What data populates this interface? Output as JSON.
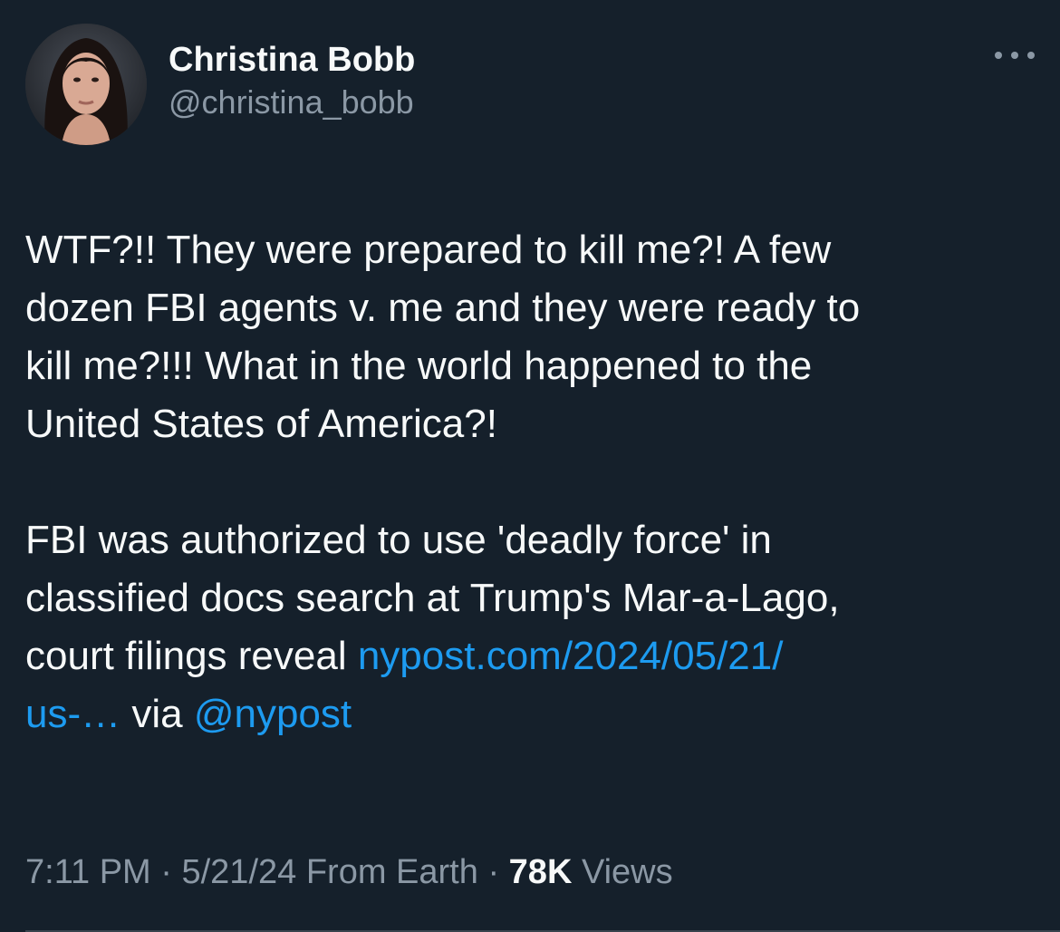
{
  "colors": {
    "background": "#15202b",
    "text": "#f7f9f9",
    "secondary_text": "#8b98a5",
    "link": "#1d9bf0"
  },
  "author": {
    "display_name": "Christina Bobb",
    "handle": "@christina_bobb",
    "avatar": "profile-photo"
  },
  "menu": {
    "icon": "more-horizontal-icon"
  },
  "tweet": {
    "paragraph_1": "WTF?!! They were prepared to kill me?! A few\ndozen FBI agents v. me and they were ready to\nkill me?!!!  What in the world happened to the\nUnited States of America?!",
    "paragraph_2_text": "FBI was authorized to use 'deadly force' in\nclassified docs search at Trump's Mar-a-Lago,\ncourt filings reveal ",
    "link_url_text": "nypost.com/2024/05/21/\nus-…",
    "via_text": " via ",
    "mention": "@nypost"
  },
  "meta": {
    "time": "7:11 PM",
    "separator_1": " · ",
    "date": "5/21/24",
    "source": " From Earth",
    "separator_2": " · ",
    "views_count": "78K",
    "views_label": " Views"
  }
}
